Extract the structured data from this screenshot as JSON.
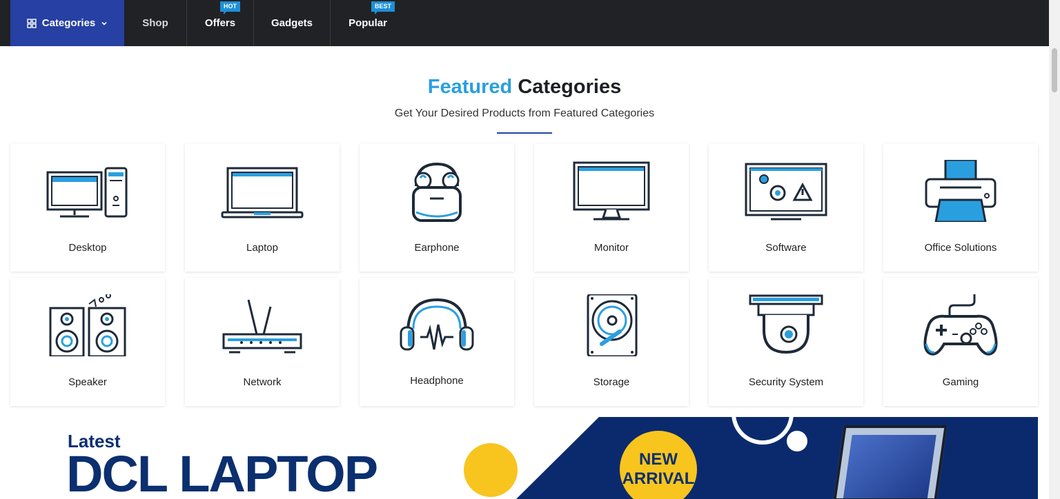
{
  "nav": {
    "categories_label": "Categories",
    "items": [
      {
        "label": "Shop",
        "badge": ""
      },
      {
        "label": "Offers",
        "badge": "HOT"
      },
      {
        "label": "Gadgets",
        "badge": ""
      },
      {
        "label": "Popular",
        "badge": "BEST"
      }
    ]
  },
  "heading": {
    "accent": "Featured",
    "rest": "Categories",
    "subtitle": "Get Your Desired Products from Featured Categories"
  },
  "categories": [
    {
      "label": "Desktop",
      "icon": "desktop-icon"
    },
    {
      "label": "Laptop",
      "icon": "laptop-icon"
    },
    {
      "label": "Earphone",
      "icon": "earphone-icon"
    },
    {
      "label": "Monitor",
      "icon": "monitor-icon"
    },
    {
      "label": "Software",
      "icon": "software-icon"
    },
    {
      "label": "Office Solutions",
      "icon": "printer-icon"
    },
    {
      "label": "Speaker",
      "icon": "speaker-icon"
    },
    {
      "label": "Network",
      "icon": "router-icon"
    },
    {
      "label": "Headphone",
      "icon": "headphone-icon"
    },
    {
      "label": "Storage",
      "icon": "hard-drive-icon"
    },
    {
      "label": "Security System",
      "icon": "security-camera-icon"
    },
    {
      "label": "Gaming",
      "icon": "gamepad-icon"
    }
  ],
  "banner": {
    "latest": "Latest",
    "title": "DCL LAPTOP",
    "badge_line1": "NEW",
    "badge_line2": "ARRIVAL"
  },
  "colors": {
    "accent": "#2a9fe0",
    "nav_bg": "#202226",
    "nav_active": "#2640a3",
    "banner_dark": "#0b2a6e",
    "banner_yellow": "#f7c51e"
  }
}
